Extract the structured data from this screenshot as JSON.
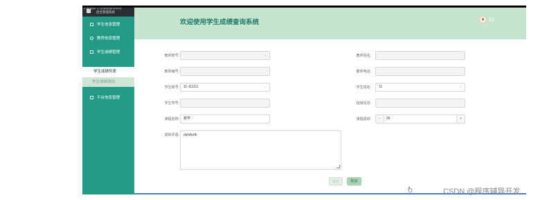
{
  "brand": {
    "line1": "2.数据库:学生成绩查询系统",
    "line2": "后台管理系统"
  },
  "sidebar": {
    "items": [
      {
        "label": "学生信息管理"
      },
      {
        "label": "教师信息管理"
      },
      {
        "label": "学生成绩管理"
      }
    ],
    "submenu": [
      {
        "label": "学生成绩列表"
      },
      {
        "label": "学生成绩添加"
      }
    ],
    "last_item": {
      "label": "平台信息管理"
    }
  },
  "header": {
    "title": "欢迎使用学生成绩查询系统",
    "user": "22"
  },
  "form": {
    "teacher_account": {
      "label": "教师账号:",
      "value": ""
    },
    "teacher_name": {
      "label": "教师姓名:",
      "value": ""
    },
    "teacher_no": {
      "label": "教师编号:",
      "value": ""
    },
    "teacher_phone": {
      "label": "教师电话:",
      "value": ""
    },
    "student_account": {
      "label": "学生账号:",
      "value": "11-111111"
    },
    "student_name": {
      "label": "学生姓名:",
      "value": "11"
    },
    "student_no": {
      "label": "学生学号:",
      "value": ""
    },
    "class_info": {
      "label": "班级信息:",
      "value": ""
    },
    "course_name": {
      "label": "课程名称:",
      "value": "数学"
    },
    "course_score": {
      "label": "课程成绩:",
      "value": "96",
      "minus": "−",
      "plus": "+"
    },
    "comment": {
      "label": "成绩评语:",
      "value": "dsfsfksfk"
    },
    "submit_label": "提交",
    "cancel_label": "取消"
  },
  "watermark": "CSDN @程序辅导开发",
  "colors": {
    "sidebar": "#229a85",
    "header": "#c7e4cf",
    "title": "#1f7e6b",
    "accent_bar": "#3d7fd6"
  }
}
